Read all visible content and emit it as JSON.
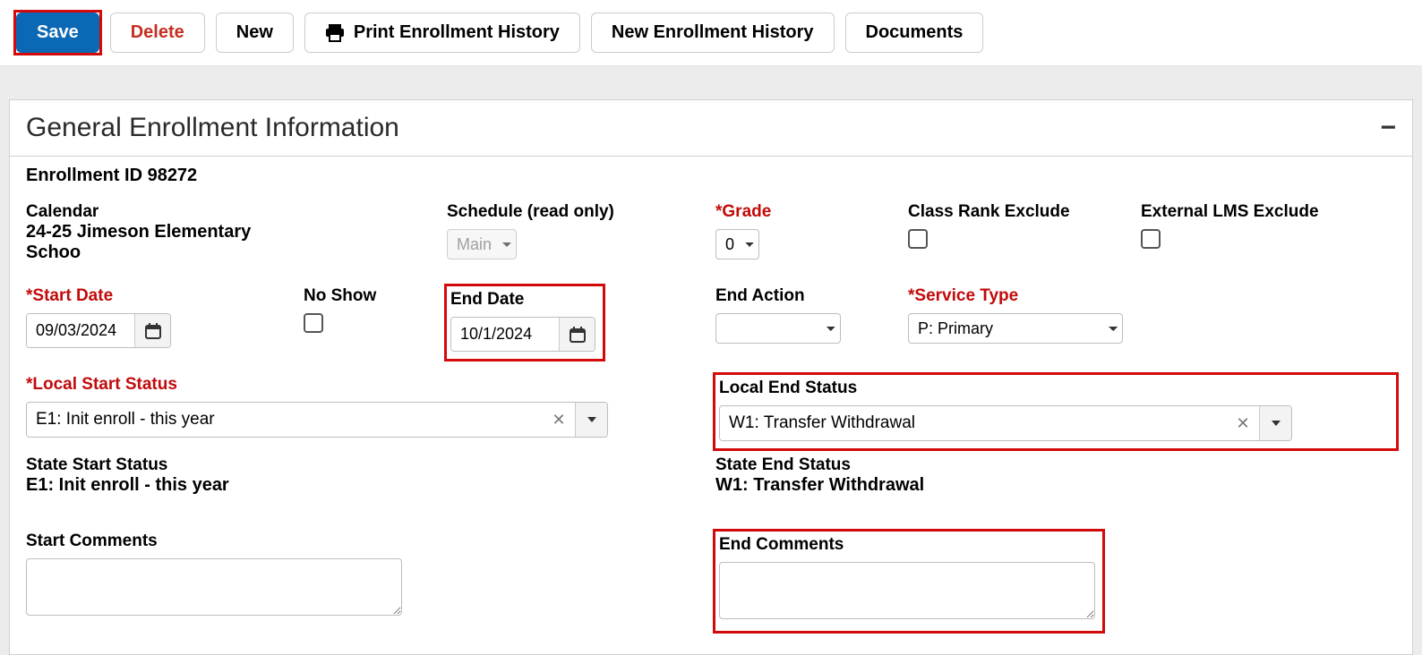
{
  "toolbar": {
    "save_label": "Save",
    "delete_label": "Delete",
    "new_label": "New",
    "print_label": "Print Enrollment History",
    "new_history_label": "New Enrollment History",
    "documents_label": "Documents"
  },
  "panel": {
    "title": "General Enrollment Information",
    "enrollment_id_label": "Enrollment ID 98272",
    "calendar": {
      "label": "Calendar",
      "value": "24-25 Jimeson Elementary Schoo"
    },
    "schedule": {
      "label": "Schedule (read only)",
      "value": "Main"
    },
    "grade": {
      "label": "*Grade",
      "value": "0"
    },
    "class_rank_exclude_label": "Class Rank Exclude",
    "external_lms_exclude_label": "External LMS Exclude",
    "start_date": {
      "label": "*Start Date",
      "value": "09/03/2024"
    },
    "no_show_label": "No Show",
    "end_date": {
      "label": "End Date",
      "value": "10/1/2024"
    },
    "end_action": {
      "label": "End Action",
      "value": ""
    },
    "service_type": {
      "label": "*Service Type",
      "value": "P: Primary"
    },
    "local_start_status": {
      "label": "*Local Start Status",
      "value": "E1: Init enroll - this year"
    },
    "local_end_status": {
      "label": "Local End Status",
      "value": "W1: Transfer Withdrawal"
    },
    "state_start_status": {
      "label": "State Start Status",
      "value": "E1: Init enroll - this year"
    },
    "state_end_status": {
      "label": "State End Status",
      "value": "W1: Transfer Withdrawal"
    },
    "start_comments_label": "Start Comments",
    "end_comments_label": "End Comments"
  }
}
